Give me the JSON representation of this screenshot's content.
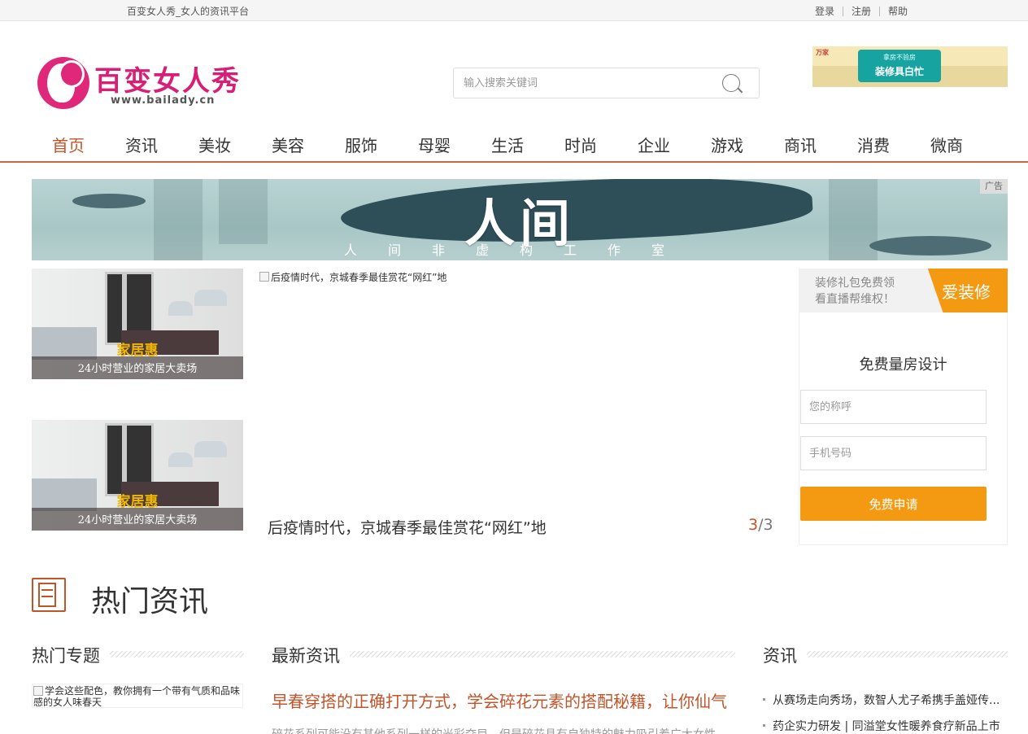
{
  "topbar": {
    "tagline": "百变女人秀_女人的资讯平台",
    "login": "登录",
    "register": "注册",
    "help": "帮助"
  },
  "logo": {
    "brand": "百变女人秀",
    "url": "www.bailady.cn"
  },
  "search": {
    "placeholder": "输入搜索关键词",
    "icon": "search-icon"
  },
  "top_ad": {
    "corner": "万家",
    "small": "拿房不验房",
    "main": "装修具白忙"
  },
  "nav": {
    "items": [
      "首页",
      "资讯",
      "美妆",
      "美容",
      "服饰",
      "母婴",
      "生活",
      "时尚",
      "企业",
      "游戏",
      "商讯",
      "消费",
      "微商"
    ],
    "active": "首页"
  },
  "banner": {
    "title": "人间",
    "subtitle": "人间非虚构工作室",
    "ad_tag": "广告"
  },
  "thumbs": [
    {
      "title": "家居惠",
      "subtitle": "24小时营业的家居大卖场"
    },
    {
      "title": "家居惠",
      "subtitle": "24小时营业的家居大卖场"
    }
  ],
  "slider": {
    "image_alt": "后疫情时代，京城春季最佳赏花“网红”地",
    "caption": "后疫情时代，京城春季最佳赏花“网红”地",
    "current": "3",
    "total": "/3"
  },
  "side_form": {
    "promo_line1": "装修礼包免费领",
    "promo_line2": "看直播帮维权！",
    "tag": "爱装修",
    "title": "免费量房设计",
    "name_placeholder": "您的称呼",
    "phone_placeholder": "手机号码",
    "submit": "免费申请"
  },
  "hot": {
    "title": "热门资讯",
    "col_topics": "热门专题",
    "col_latest": "最新资讯",
    "col_news": "资讯",
    "topic_image_alt": "学会这些配色，教你拥有一个带有气质和品味感的女人味春天",
    "latest_headline": "早春穿搭的正确打开方式，学会碎花元素的搭配秘籍，让你仙气",
    "latest_summary": "碎花系列可能没有其他系列一样的光彩夺目，但是碎花具有自独特的魅力吸引着广大女性",
    "news_items": [
      "从赛场走向秀场，数智人尤子希携手盖娅传...",
      "药企实力研发 | 同溢堂女性暖养食疗新品上市"
    ]
  }
}
